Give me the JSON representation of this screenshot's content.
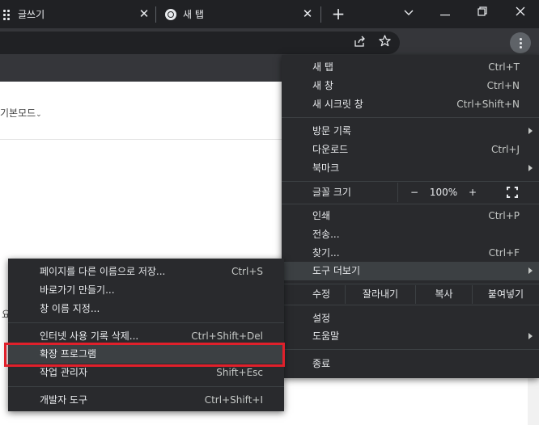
{
  "tabs": [
    {
      "title": "글쓰기"
    },
    {
      "title": "새 탭"
    }
  ],
  "window": {
    "minimize": "—",
    "restore": "❐",
    "close": "✕"
  },
  "page": {
    "view_mode": "기본모드",
    "fragment": "요"
  },
  "menu": {
    "items_top": [
      {
        "label": "새 탭",
        "shortcut": "Ctrl+T"
      },
      {
        "label": "새 창",
        "shortcut": "Ctrl+N"
      },
      {
        "label": "새 시크릿 창",
        "shortcut": "Ctrl+Shift+N"
      }
    ],
    "items_history": [
      {
        "label": "방문 기록",
        "shortcut": ""
      },
      {
        "label": "다운로드",
        "shortcut": "Ctrl+J"
      },
      {
        "label": "북마크",
        "shortcut": ""
      }
    ],
    "zoom": {
      "label": "글꼴 크기",
      "minus": "−",
      "value": "100%",
      "plus": "+"
    },
    "items_tools": [
      {
        "label": "인쇄",
        "shortcut": "Ctrl+P"
      },
      {
        "label": "전송...",
        "shortcut": ""
      },
      {
        "label": "찾기...",
        "shortcut": "Ctrl+F"
      },
      {
        "label": "도구 더보기",
        "shortcut": ""
      }
    ],
    "edit": {
      "label": "수정",
      "cut": "잘라내기",
      "copy": "복사",
      "paste": "붙여넣기"
    },
    "items_settings": [
      {
        "label": "설정",
        "shortcut": ""
      },
      {
        "label": "도움말",
        "shortcut": ""
      }
    ],
    "exit": {
      "label": "종료"
    }
  },
  "submenu": {
    "items": [
      {
        "label": "페이지를 다른 이름으로 저장...",
        "shortcut": "Ctrl+S"
      },
      {
        "label": "바로가기 만들기...",
        "shortcut": ""
      },
      {
        "label": "창 이름 지정...",
        "shortcut": ""
      },
      {
        "label": "인터넷 사용 기록 삭제...",
        "shortcut": "Ctrl+Shift+Del"
      },
      {
        "label": "확장 프로그램",
        "shortcut": ""
      },
      {
        "label": "작업 관리자",
        "shortcut": "Shift+Esc"
      },
      {
        "label": "개발자 도구",
        "shortcut": "Ctrl+Shift+I"
      }
    ],
    "highlighted": "확장 프로그램"
  },
  "colors": {
    "menu_bg": "#292a2d",
    "hover_bg": "#3c4043",
    "annotation_red": "#e0202b"
  }
}
